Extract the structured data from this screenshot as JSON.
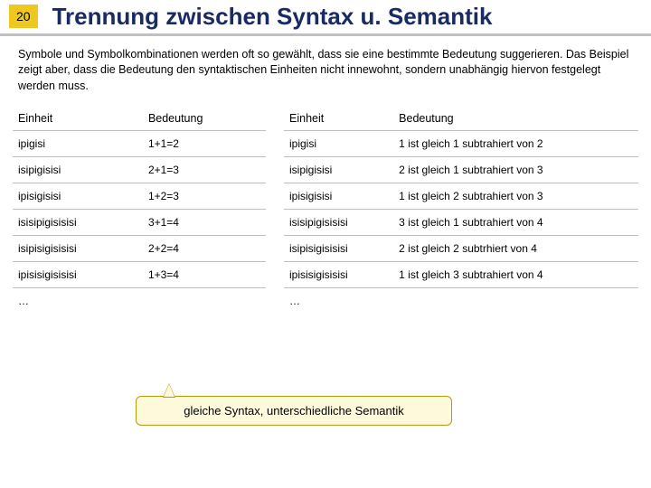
{
  "page_number": "20",
  "title": "Trennung zwischen Syntax u. Semantik",
  "intro": "Symbole und Symbolkombinationen werden oft so gewählt, dass sie eine bestimmte Bedeutung suggerieren. Das Beispiel zeigt aber, dass die Bedeutung den syntaktischen Einheiten nicht innewohnt, sondern unabhängig hiervon festgelegt werden muss.",
  "table_left": {
    "head": {
      "c0": "Einheit",
      "c1": "Bedeutung"
    },
    "rows": [
      {
        "c0": "ipigisi",
        "c1": "1+1=2"
      },
      {
        "c0": "isipigisisi",
        "c1": "2+1=3"
      },
      {
        "c0": "ipisigisisi",
        "c1": "1+2=3"
      },
      {
        "c0": "isisipigisisisi",
        "c1": "3+1=4"
      },
      {
        "c0": "isipisigisisisi",
        "c1": "2+2=4"
      },
      {
        "c0": "ipisisigisisisi",
        "c1": "1+3=4"
      },
      {
        "c0": "…",
        "c1": ""
      }
    ]
  },
  "table_right": {
    "head": {
      "c0": "Einheit",
      "c1": "Bedeutung"
    },
    "rows": [
      {
        "c0": "ipigisi",
        "c1": "1 ist gleich 1 subtrahiert von 2"
      },
      {
        "c0": "isipigisisi",
        "c1": "2 ist gleich 1 subtrahiert von 3"
      },
      {
        "c0": "ipisigisisi",
        "c1": "1 ist gleich 2 subtrahiert von 3"
      },
      {
        "c0": "isisipigisisisi",
        "c1": "3 ist gleich 1 subtrahiert von 4"
      },
      {
        "c0": "isipisigisisisi",
        "c1": "2 ist gleich 2 subtrhiert von 4"
      },
      {
        "c0": "ipisisigisisisi",
        "c1": "1 ist gleich 3 subtrahiert von 4"
      },
      {
        "c0": "…",
        "c1": ""
      }
    ]
  },
  "callout": "gleiche Syntax, unterschiedliche Semantik"
}
